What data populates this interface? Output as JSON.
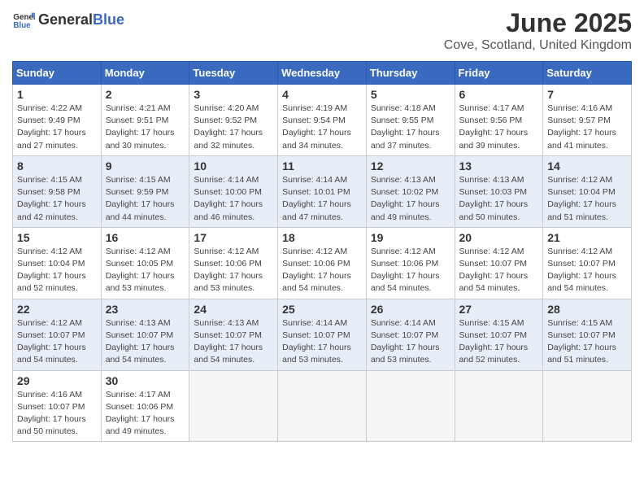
{
  "header": {
    "logo_general": "General",
    "logo_blue": "Blue",
    "title": "June 2025",
    "subtitle": "Cove, Scotland, United Kingdom"
  },
  "weekdays": [
    "Sunday",
    "Monday",
    "Tuesday",
    "Wednesday",
    "Thursday",
    "Friday",
    "Saturday"
  ],
  "weeks": [
    {
      "days": [
        {
          "num": "1",
          "info": "Sunrise: 4:22 AM\nSunset: 9:49 PM\nDaylight: 17 hours\nand 27 minutes."
        },
        {
          "num": "2",
          "info": "Sunrise: 4:21 AM\nSunset: 9:51 PM\nDaylight: 17 hours\nand 30 minutes."
        },
        {
          "num": "3",
          "info": "Sunrise: 4:20 AM\nSunset: 9:52 PM\nDaylight: 17 hours\nand 32 minutes."
        },
        {
          "num": "4",
          "info": "Sunrise: 4:19 AM\nSunset: 9:54 PM\nDaylight: 17 hours\nand 34 minutes."
        },
        {
          "num": "5",
          "info": "Sunrise: 4:18 AM\nSunset: 9:55 PM\nDaylight: 17 hours\nand 37 minutes."
        },
        {
          "num": "6",
          "info": "Sunrise: 4:17 AM\nSunset: 9:56 PM\nDaylight: 17 hours\nand 39 minutes."
        },
        {
          "num": "7",
          "info": "Sunrise: 4:16 AM\nSunset: 9:57 PM\nDaylight: 17 hours\nand 41 minutes."
        }
      ]
    },
    {
      "days": [
        {
          "num": "8",
          "info": "Sunrise: 4:15 AM\nSunset: 9:58 PM\nDaylight: 17 hours\nand 42 minutes."
        },
        {
          "num": "9",
          "info": "Sunrise: 4:15 AM\nSunset: 9:59 PM\nDaylight: 17 hours\nand 44 minutes."
        },
        {
          "num": "10",
          "info": "Sunrise: 4:14 AM\nSunset: 10:00 PM\nDaylight: 17 hours\nand 46 minutes."
        },
        {
          "num": "11",
          "info": "Sunrise: 4:14 AM\nSunset: 10:01 PM\nDaylight: 17 hours\nand 47 minutes."
        },
        {
          "num": "12",
          "info": "Sunrise: 4:13 AM\nSunset: 10:02 PM\nDaylight: 17 hours\nand 49 minutes."
        },
        {
          "num": "13",
          "info": "Sunrise: 4:13 AM\nSunset: 10:03 PM\nDaylight: 17 hours\nand 50 minutes."
        },
        {
          "num": "14",
          "info": "Sunrise: 4:12 AM\nSunset: 10:04 PM\nDaylight: 17 hours\nand 51 minutes."
        }
      ]
    },
    {
      "days": [
        {
          "num": "15",
          "info": "Sunrise: 4:12 AM\nSunset: 10:04 PM\nDaylight: 17 hours\nand 52 minutes."
        },
        {
          "num": "16",
          "info": "Sunrise: 4:12 AM\nSunset: 10:05 PM\nDaylight: 17 hours\nand 53 minutes."
        },
        {
          "num": "17",
          "info": "Sunrise: 4:12 AM\nSunset: 10:06 PM\nDaylight: 17 hours\nand 53 minutes."
        },
        {
          "num": "18",
          "info": "Sunrise: 4:12 AM\nSunset: 10:06 PM\nDaylight: 17 hours\nand 54 minutes."
        },
        {
          "num": "19",
          "info": "Sunrise: 4:12 AM\nSunset: 10:06 PM\nDaylight: 17 hours\nand 54 minutes."
        },
        {
          "num": "20",
          "info": "Sunrise: 4:12 AM\nSunset: 10:07 PM\nDaylight: 17 hours\nand 54 minutes."
        },
        {
          "num": "21",
          "info": "Sunrise: 4:12 AM\nSunset: 10:07 PM\nDaylight: 17 hours\nand 54 minutes."
        }
      ]
    },
    {
      "days": [
        {
          "num": "22",
          "info": "Sunrise: 4:12 AM\nSunset: 10:07 PM\nDaylight: 17 hours\nand 54 minutes."
        },
        {
          "num": "23",
          "info": "Sunrise: 4:13 AM\nSunset: 10:07 PM\nDaylight: 17 hours\nand 54 minutes."
        },
        {
          "num": "24",
          "info": "Sunrise: 4:13 AM\nSunset: 10:07 PM\nDaylight: 17 hours\nand 54 minutes."
        },
        {
          "num": "25",
          "info": "Sunrise: 4:14 AM\nSunset: 10:07 PM\nDaylight: 17 hours\nand 53 minutes."
        },
        {
          "num": "26",
          "info": "Sunrise: 4:14 AM\nSunset: 10:07 PM\nDaylight: 17 hours\nand 53 minutes."
        },
        {
          "num": "27",
          "info": "Sunrise: 4:15 AM\nSunset: 10:07 PM\nDaylight: 17 hours\nand 52 minutes."
        },
        {
          "num": "28",
          "info": "Sunrise: 4:15 AM\nSunset: 10:07 PM\nDaylight: 17 hours\nand 51 minutes."
        }
      ]
    },
    {
      "days": [
        {
          "num": "29",
          "info": "Sunrise: 4:16 AM\nSunset: 10:07 PM\nDaylight: 17 hours\nand 50 minutes."
        },
        {
          "num": "30",
          "info": "Sunrise: 4:17 AM\nSunset: 10:06 PM\nDaylight: 17 hours\nand 49 minutes."
        },
        {
          "num": "",
          "info": ""
        },
        {
          "num": "",
          "info": ""
        },
        {
          "num": "",
          "info": ""
        },
        {
          "num": "",
          "info": ""
        },
        {
          "num": "",
          "info": ""
        }
      ]
    }
  ]
}
